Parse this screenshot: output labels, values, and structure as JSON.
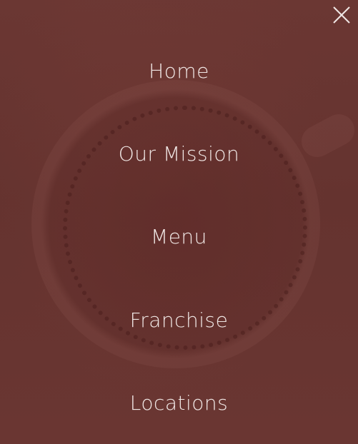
{
  "menu": {
    "items": [
      {
        "label": "Home"
      },
      {
        "label": "Our Mission"
      },
      {
        "label": "Menu"
      },
      {
        "label": "Franchise"
      },
      {
        "label": "Locations"
      }
    ]
  },
  "close": {
    "icon": "close-icon"
  },
  "colors": {
    "background": "#6a3632",
    "text": "#f0e7e5"
  }
}
